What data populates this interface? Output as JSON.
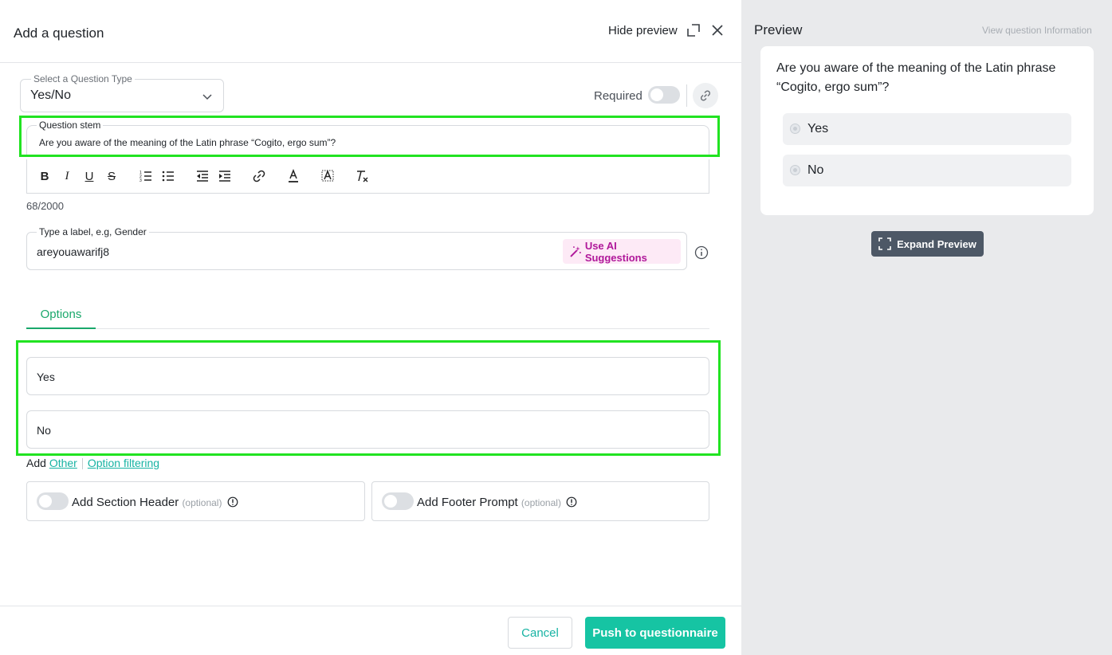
{
  "header": {
    "title": "Add a question",
    "hide_preview": "Hide preview",
    "icons": [
      "expand-window-icon",
      "close-icon"
    ]
  },
  "question_type": {
    "legend": "Select a Question Type",
    "value": "Yes/No"
  },
  "required": {
    "label": "Required",
    "enabled": false
  },
  "stem": {
    "legend": "Question stem",
    "value": "Are you aware of the meaning of the Latin phrase “Cogito, ergo sum”?",
    "counter": "68/2000"
  },
  "toolbar": {
    "buttons": [
      "bold",
      "italic",
      "underline",
      "strikethrough",
      "ordered-list",
      "bullet-list",
      "outdent",
      "indent",
      "link",
      "font-color",
      "highlight",
      "clear-format"
    ]
  },
  "label_field": {
    "legend": "Type a label, e.g, Gender",
    "value": "areyouawarifj8",
    "ai_button": "Use AI Suggestions"
  },
  "tabs": {
    "options": "Options"
  },
  "options": [
    "Yes",
    "No"
  ],
  "add_row": {
    "add": "Add",
    "other": "Other",
    "option_filtering": "Option filtering"
  },
  "section_header": {
    "label": "Add Section Header",
    "optional": "(optional)"
  },
  "footer_prompt": {
    "label": "Add Footer Prompt",
    "optional": "(optional)"
  },
  "footer": {
    "cancel": "Cancel",
    "push": "Push to questionnaire"
  },
  "preview": {
    "title": "Preview",
    "info_link": "View question Information",
    "question": "Are you aware of the meaning of the Latin phrase “Cogito, ergo sum”?",
    "options": [
      "Yes",
      "No"
    ],
    "expand": "Expand Preview"
  },
  "colors": {
    "accent": "#16c4a3",
    "tab_green": "#1aa86b",
    "highlight_box": "#21e321",
    "ai_pink": "#b0189a",
    "expand_bg": "#4d5866"
  }
}
